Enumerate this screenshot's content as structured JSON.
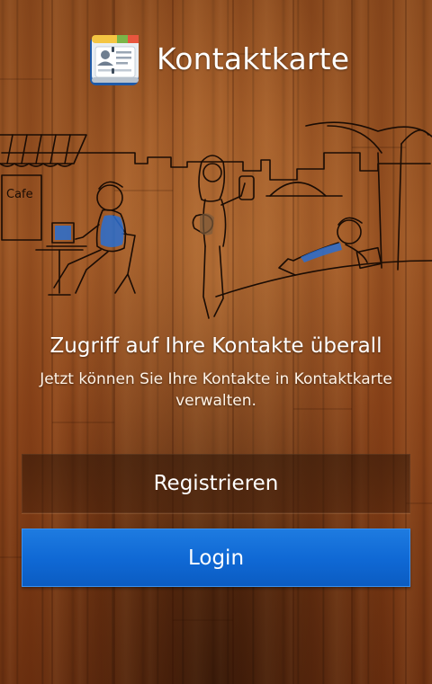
{
  "app": {
    "title": "Kontaktkarte",
    "icon": "contact-card-icon"
  },
  "illustration": {
    "cafe_sign": "Cafe"
  },
  "intro": {
    "headline": "Zugriff auf Ihre Kontakte überall",
    "description": "Jetzt können Sie Ihre Kontakte in Kontaktkarte verwalten."
  },
  "actions": {
    "register_label": "Registrieren",
    "login_label": "Login"
  },
  "colors": {
    "login_button": "#0f68d4",
    "wood_background": "#8a4a1e"
  }
}
